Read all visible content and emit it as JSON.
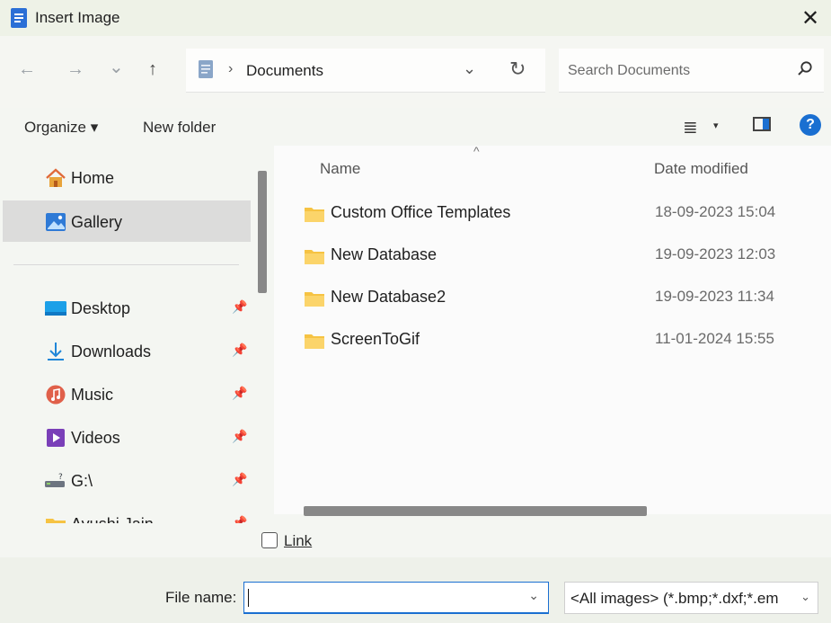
{
  "window": {
    "title": "Insert Image",
    "close": "✕"
  },
  "nav": {
    "back": "←",
    "forward": "→",
    "recent": "⌄",
    "up": "↑",
    "address": {
      "separator": "›",
      "location": "Documents",
      "dropdown": "⌄",
      "refresh": "↻"
    },
    "search": {
      "placeholder": "Search Documents"
    }
  },
  "toolbar": {
    "organize": "Organize ▾",
    "new_folder": "New folder",
    "view": "≣",
    "view_caret": "▾",
    "help": "?"
  },
  "sidebar": {
    "items": [
      {
        "label": "Home",
        "icon": "home-icon"
      },
      {
        "label": "Gallery",
        "icon": "gallery-icon",
        "selected": true
      },
      {
        "label": "Desktop",
        "icon": "desktop-icon",
        "pinned": true
      },
      {
        "label": "Downloads",
        "icon": "downloads-icon",
        "pinned": true
      },
      {
        "label": "Music",
        "icon": "music-icon",
        "pinned": true
      },
      {
        "label": "Videos",
        "icon": "videos-icon",
        "pinned": true
      },
      {
        "label": "G:\\",
        "icon": "drive-icon",
        "pinned": true
      },
      {
        "label": "Ayushi Jain",
        "icon": "folder-icon",
        "pinned": true
      }
    ],
    "pin": "📌"
  },
  "files": {
    "columns": {
      "name": "Name",
      "date": "Date modified",
      "sort": "^"
    },
    "rows": [
      {
        "name": "Custom Office Templates",
        "date": "18-09-2023 15:04"
      },
      {
        "name": "New Database",
        "date": "19-09-2023 12:03"
      },
      {
        "name": "New Database2",
        "date": "19-09-2023 11:34"
      },
      {
        "name": "ScreenToGif",
        "date": "11-01-2024 15:55"
      }
    ]
  },
  "link": {
    "label": "Link"
  },
  "footer": {
    "file_name_label": "File name:",
    "file_name_value": "",
    "filter": "<All images> (*.bmp;*.dxf;*.em",
    "chevron": "⌄"
  },
  "colors": {
    "accent": "#1a6fd1",
    "folder": "#f6c343",
    "titlebar": "#eef2e7"
  }
}
